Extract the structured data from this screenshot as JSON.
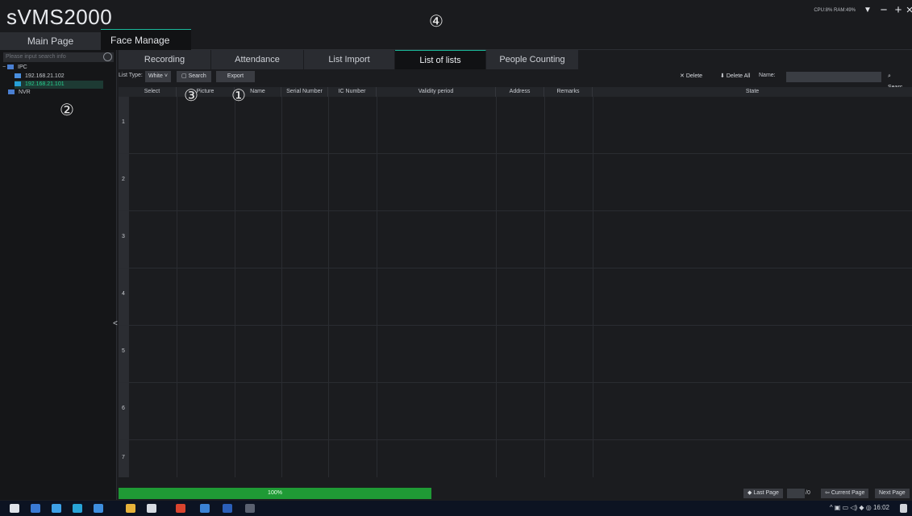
{
  "app": {
    "title": "sVMS2000"
  },
  "header": {
    "main_tab": "Main Page",
    "face_tab": "Face Manage",
    "sys_info": "CPU:8% RAM:49%"
  },
  "markers": [
    "①",
    "②",
    "③",
    "④"
  ],
  "sidebar": {
    "search_placeholder": "Please input search info",
    "tree": [
      {
        "label": "IPC",
        "toggle": "−"
      },
      {
        "label": "192.168.21.102"
      },
      {
        "label": "192.168.21.101"
      },
      {
        "label": "NVR"
      }
    ]
  },
  "tabs": [
    "Recording",
    "Attendance",
    "List Import",
    "List of lists",
    "People Counting"
  ],
  "toolbar": {
    "list_type_label": "List Type:",
    "list_type_value": "White",
    "search": "Search",
    "export": "Export",
    "delete": "Delete",
    "delete_all": "Delete All",
    "name_label": "Name:",
    "search_right": "Searc"
  },
  "table": {
    "columns": [
      "Select",
      "Picture",
      "Name",
      "Serial Number",
      "IC Number",
      "Validity period",
      "Address",
      "Remarks",
      "State"
    ],
    "rows": [
      "1",
      "2",
      "3",
      "4",
      "5",
      "6",
      "7"
    ]
  },
  "footer": {
    "progress": "100%",
    "last_page": "Last Page",
    "page_total": "/0",
    "current_page": "Current Page",
    "next_page": "Next Page"
  },
  "taskbar": {
    "time": "16:02"
  },
  "colors": {
    "accent": "#1ab99a",
    "progress": "#1f9a35",
    "selected_text": "#27d08f"
  }
}
